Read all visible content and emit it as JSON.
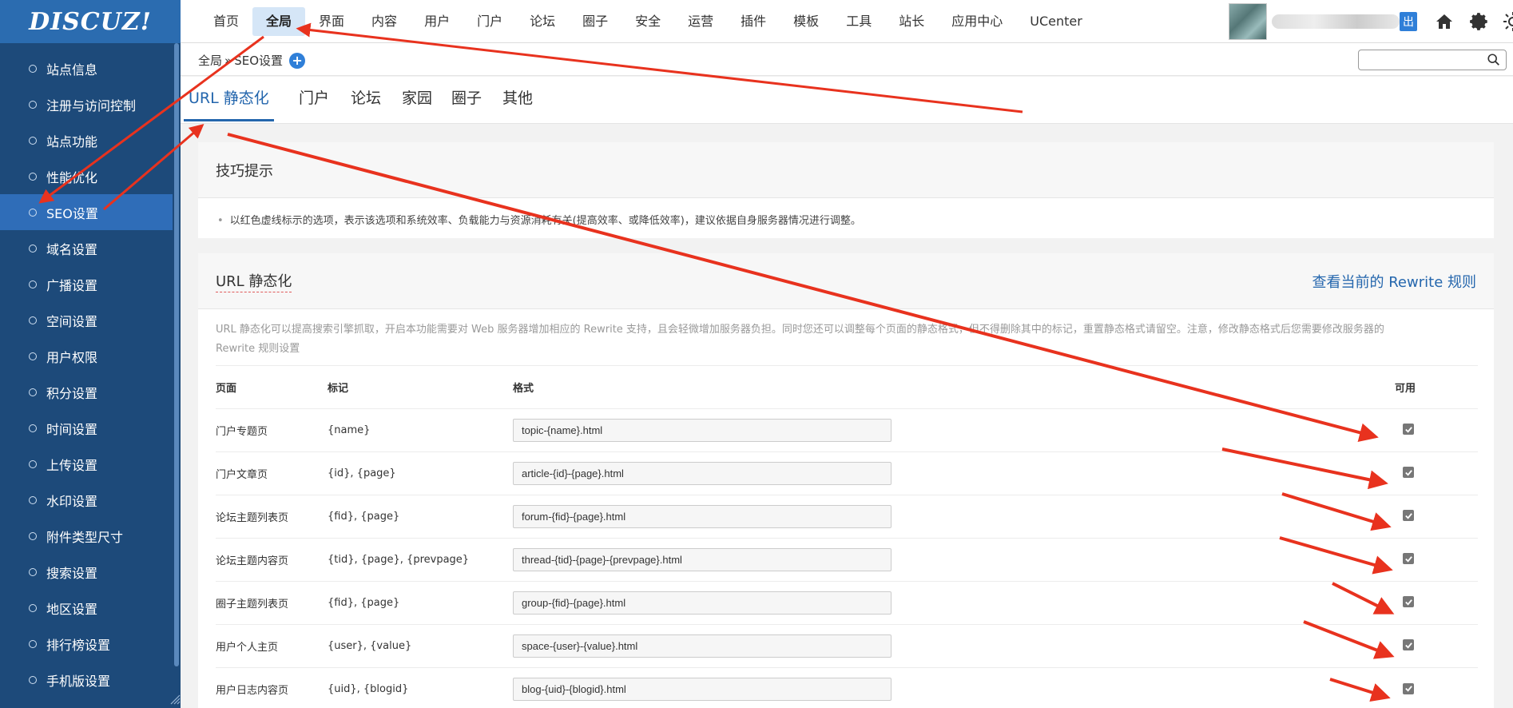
{
  "header": {
    "logo_text": "DISCUZ!",
    "nav": [
      "首页",
      "全局",
      "界面",
      "内容",
      "用户",
      "门户",
      "论坛",
      "圈子",
      "安全",
      "运营",
      "插件",
      "模板",
      "工具",
      "站长",
      "应用中心",
      "UCenter"
    ],
    "active_nav": "全局",
    "logout_label": "出",
    "icons": [
      "home-icon",
      "gear-icon",
      "sun-icon"
    ]
  },
  "sidebar": {
    "items": [
      "站点信息",
      "注册与访问控制",
      "站点功能",
      "性能优化",
      "SEO设置",
      "域名设置",
      "广播设置",
      "空间设置",
      "用户权限",
      "积分设置",
      "时间设置",
      "上传设置",
      "水印设置",
      "附件类型尺寸",
      "搜索设置",
      "地区设置",
      "排行榜设置",
      "手机版设置"
    ],
    "active": "SEO设置"
  },
  "breadcrumb": {
    "root": "全局",
    "sep": "»",
    "current": "SEO设置"
  },
  "search": {
    "value": "",
    "placeholder": ""
  },
  "tabs": [
    "URL 静态化",
    "门户",
    "论坛",
    "家园",
    "圈子",
    "其他"
  ],
  "tips": {
    "title": "技巧提示",
    "text": "以红色虚线标示的选项，表示该选项和系统效率、负载能力与资源消耗有关(提高效率、或降低效率)，建议依据自身服务器情况进行调整。"
  },
  "url_panel": {
    "title": "URL 静态化",
    "link": "查看当前的 Rewrite 规则",
    "description": "URL 静态化可以提高搜索引擎抓取，开启本功能需要对 Web 服务器增加相应的 Rewrite 支持，且会轻微增加服务器负担。同时您还可以调整每个页面的静态格式，但不得删除其中的标记，重置静态格式请留空。注意，修改静态格式后您需要修改服务器的 Rewrite 规则设置",
    "columns": [
      "页面",
      "标记",
      "格式",
      "可用"
    ],
    "rows": [
      {
        "page": "门户专题页",
        "marks": "{name}",
        "format": "topic-{name}.html",
        "enabled": true
      },
      {
        "page": "门户文章页",
        "marks": "{id}, {page}",
        "format": "article-{id}-{page}.html",
        "enabled": true
      },
      {
        "page": "论坛主题列表页",
        "marks": "{fid}, {page}",
        "format": "forum-{fid}-{page}.html",
        "enabled": true
      },
      {
        "page": "论坛主题内容页",
        "marks": "{tid}, {page}, {prevpage}",
        "format": "thread-{tid}-{page}-{prevpage}.html",
        "enabled": true
      },
      {
        "page": "圈子主题列表页",
        "marks": "{fid}, {page}",
        "format": "group-{fid}-{page}.html",
        "enabled": true
      },
      {
        "page": "用户个人主页",
        "marks": "{user}, {value}",
        "format": "space-{user}-{value}.html",
        "enabled": true
      },
      {
        "page": "用户日志内容页",
        "marks": "{uid}, {blogid}",
        "format": "blog-{uid}-{blogid}.html",
        "enabled": true
      }
    ]
  },
  "colors": {
    "accent": "#2466ad",
    "sidebar": "#1d4a7a",
    "sidebar_active": "#2f6db8",
    "annotation": "#e8321e"
  }
}
